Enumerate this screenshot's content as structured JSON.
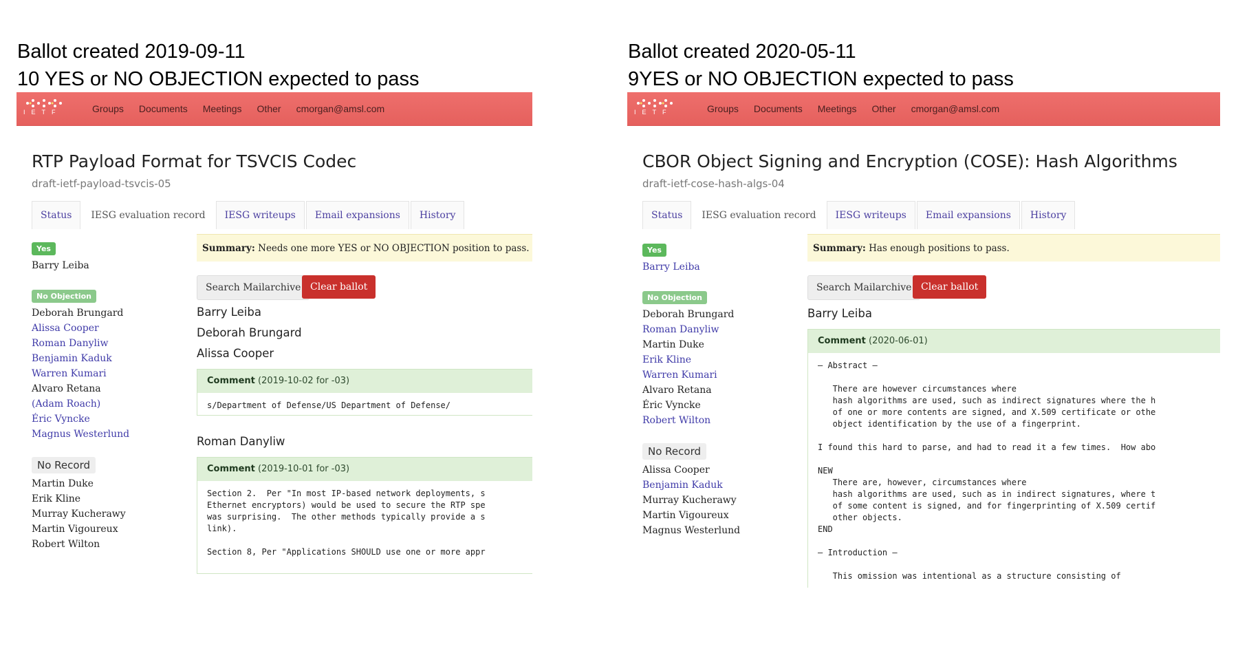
{
  "left": {
    "caption": {
      "line1": "Ballot created 2019-09-11",
      "line2": "10 YES or NO OBJECTION expected to pass"
    },
    "navbar": {
      "logo_text": "IETF",
      "links": [
        "Groups",
        "Documents",
        "Meetings",
        "Other",
        "cmorgan@amsl.com"
      ]
    },
    "title": "RTP Payload Format for TSVCIS Codec",
    "draft": "draft-ietf-payload-tsvcis-05",
    "tabs": [
      "Status",
      "IESG evaluation record",
      "IESG writeups",
      "Email expansions",
      "History"
    ],
    "positions": {
      "yes": {
        "label": "Yes",
        "people": [
          "Barry Leiba"
        ]
      },
      "no_objection": {
        "label": "No Objection",
        "people": [
          "Deborah Brungard",
          "Alissa Cooper",
          "Roman Danyliw",
          "Benjamin Kaduk",
          "Warren Kumari",
          "Alvaro Retana",
          "(Adam Roach)",
          "Éric Vyncke",
          "Magnus Westerlund"
        ]
      },
      "no_record": {
        "label": "No Record",
        "people": [
          "Martin Duke",
          "Erik Kline",
          "Murray Kucherawy",
          "Martin Vigoureux",
          "Robert Wilton"
        ]
      }
    },
    "summary": {
      "label": "Summary:",
      "text": "Needs one more YES or NO OBJECTION position to pass."
    },
    "buttons": {
      "search": "Search Mailarchive",
      "clear": "Clear ballot"
    },
    "names": [
      "Barry Leiba",
      "Deborah Brungard",
      "Alissa Cooper"
    ],
    "comment1": {
      "label": "Comment",
      "date": "(2019-10-02 for -03)",
      "lines": [
        "s/Department of Defense/US Department of Defense/"
      ]
    },
    "name2": "Roman Danyliw",
    "comment2": {
      "label": "Comment",
      "date": "(2019-10-01 for -03)",
      "lines": [
        "Section 2.  Per \"In most IP-based network deployments, s",
        "Ethernet encryptors) would be used to secure the RTP spe",
        "was surprising.  The other methods typically provide a s",
        "link).",
        "",
        "Section 8, Per \"Applications SHOULD use one or more appr"
      ]
    }
  },
  "right": {
    "caption": {
      "line1": "Ballot created 2020-05-11",
      "line2": "9YES or NO OBJECTION expected to pass"
    },
    "navbar": {
      "logo_text": "IETF",
      "links": [
        "Groups",
        "Documents",
        "Meetings",
        "Other",
        "cmorgan@amsl.com"
      ]
    },
    "title": "CBOR Object Signing and Encryption (COSE): Hash Algorithms",
    "draft": "draft-ietf-cose-hash-algs-04",
    "tabs": [
      "Status",
      "IESG evaluation record",
      "IESG writeups",
      "Email expansions",
      "History"
    ],
    "positions": {
      "yes": {
        "label": "Yes",
        "people": [
          "Barry Leiba"
        ]
      },
      "no_objection": {
        "label": "No Objection",
        "people": [
          "Deborah Brungard",
          "Roman Danyliw",
          "Martin Duke",
          "Erik Kline",
          "Warren Kumari",
          "Alvaro Retana",
          "Éric Vyncke",
          "Robert Wilton"
        ]
      },
      "no_record": {
        "label": "No Record",
        "people": [
          "Alissa Cooper",
          "Benjamin Kaduk",
          "Murray Kucherawy",
          "Martin Vigoureux",
          "Magnus Westerlund"
        ]
      }
    },
    "summary": {
      "label": "Summary:",
      "text": "Has enough positions to pass."
    },
    "buttons": {
      "search": "Search Mailarchive",
      "clear": "Clear ballot"
    },
    "name1": "Barry Leiba",
    "comment1": {
      "label": "Comment",
      "date": "(2020-06-01)",
      "lines": [
        "— Abstract —",
        "",
        "   There are however circumstances where",
        "   hash algorithms are used, such as indirect signatures where the h",
        "   of one or more contents are signed, and X.509 certificate or othe",
        "   object identification by the use of a fingerprint.",
        "",
        "I found this hard to parse, and had to read it a few times.  How abo",
        "",
        "NEW",
        "   There are, however, circumstances where",
        "   hash algorithms are used, such as in indirect signatures, where t",
        "   of some content is signed, and for fingerprinting of X.509 certif",
        "   other objects.",
        "END",
        "",
        "— Introduction —",
        "",
        "   This omission was intentional as a structure consisting of"
      ]
    }
  }
}
